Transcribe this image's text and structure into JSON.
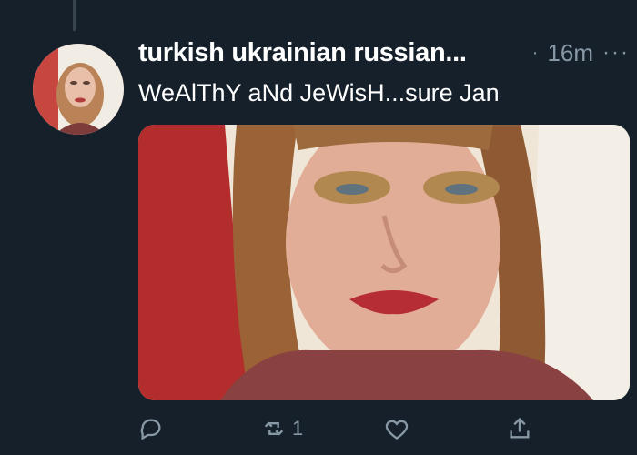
{
  "tweet": {
    "author": "turkish ukrainian russian...",
    "separator": "·",
    "time": "16m",
    "more": "···",
    "text": "WeAlThY aNd JeWisH...sure Jan"
  },
  "actions": {
    "reply_icon": "reply-icon",
    "retweet_icon": "retweet-icon",
    "retweet_count": "1",
    "like_icon": "heart-icon",
    "share_icon": "share-icon"
  },
  "colors": {
    "background": "#15202b",
    "secondary_text": "#8899a6",
    "thread_line": "#38444d"
  }
}
